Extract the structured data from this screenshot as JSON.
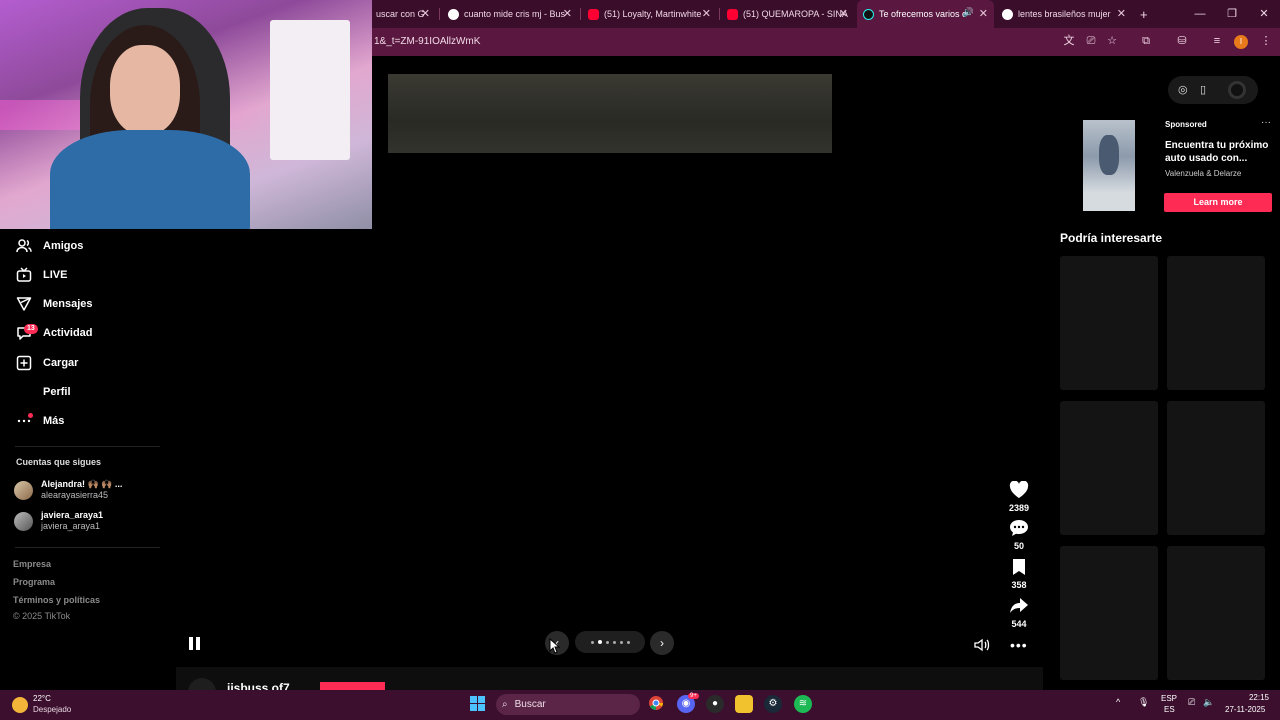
{
  "browser": {
    "tabs": [
      {
        "title": "uscar con G",
        "favicon": "google-icon"
      },
      {
        "title": "cuanto mide cris mj - Bus",
        "favicon": "google-icon"
      },
      {
        "title": "(51) Loyalty, Martinwhite",
        "favicon": "youtube-icon"
      },
      {
        "title": "(51) QUEMAROPA - SINA",
        "favicon": "youtube-icon"
      },
      {
        "title": "Te ofrecemos varios c",
        "favicon": "tiktok-icon"
      },
      {
        "title": "lentes brasileños mujer",
        "favicon": "google-icon"
      }
    ],
    "new_tab": "+",
    "url": "1&_t=ZM-91IOAllzWmK",
    "profile_initial": "I",
    "accent_color": "#5a1840"
  },
  "nav": {
    "items": [
      {
        "label": "Amigos",
        "icon": "friends-icon"
      },
      {
        "label": "LIVE",
        "icon": "live-icon"
      },
      {
        "label": "Mensajes",
        "icon": "messages-icon"
      },
      {
        "label": "Actividad",
        "icon": "activity-icon",
        "badge": "13"
      },
      {
        "label": "Cargar",
        "icon": "upload-icon"
      },
      {
        "label": "Perfil",
        "icon": "profile-icon"
      },
      {
        "label": "Más",
        "icon": "more-icon"
      }
    ],
    "following_title": "Cuentas que sigues",
    "following": [
      {
        "name": "Alejandra! 🙌🏽 🙌🏽 ...",
        "handle": "alearayasierra45"
      },
      {
        "name": "javiera_araya1",
        "handle": "javiera_araya1"
      }
    ],
    "footer": [
      "Empresa",
      "Programa",
      "Términos y políticas",
      "© 2025 TikTok"
    ]
  },
  "video": {
    "actions": [
      {
        "icon": "heart-icon",
        "count": "2389"
      },
      {
        "icon": "comment-icon",
        "count": "50"
      },
      {
        "icon": "bookmark-icon",
        "count": "358"
      },
      {
        "icon": "share-icon",
        "count": "544"
      }
    ],
    "next_username": "jjsbuss of7"
  },
  "ad": {
    "sponsored": "Sponsored",
    "title": "Encuentra tu próximo auto usado con...",
    "brand": "Valenzuela & Delarze",
    "cta": "Learn more",
    "menu": "···"
  },
  "recommendations": {
    "title": "Podría interesarte"
  },
  "taskbar": {
    "weather_temp": "22°C",
    "weather_desc": "Despejado",
    "search_label": "Buscar",
    "lang_top": "ESP",
    "lang_bottom": "ES",
    "time": "22:15",
    "date": "27-11-2025",
    "discord_badge": "9+"
  },
  "colors": {
    "tiktok_red": "#fe2c55",
    "taskbar": "#3b0f2d"
  }
}
